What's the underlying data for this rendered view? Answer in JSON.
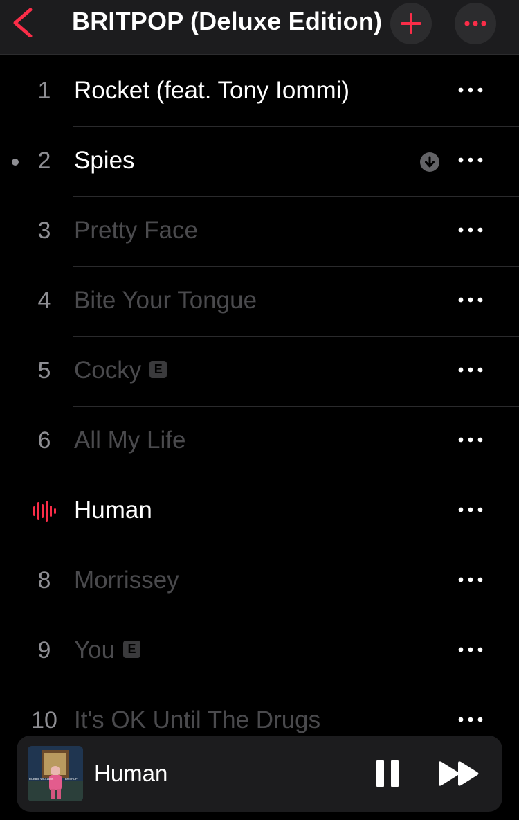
{
  "header": {
    "title": "BRITPOP (Deluxe Edition)",
    "back_icon": "chevron-left-icon",
    "add_icon": "plus-icon",
    "more_icon": "ellipsis-icon",
    "accent_color": "#fa2d48"
  },
  "tracks": [
    {
      "number": "1",
      "title": "Rocket (feat. Tony Iommi)",
      "state": "available",
      "explicit": false
    },
    {
      "number": "2",
      "title": "Spies",
      "state": "available",
      "explicit": false,
      "downloaded": true,
      "marked": true
    },
    {
      "number": "3",
      "title": "Pretty Face",
      "state": "unavailable",
      "explicit": false
    },
    {
      "number": "4",
      "title": "Bite Your Tongue",
      "state": "unavailable",
      "explicit": false
    },
    {
      "number": "5",
      "title": "Cocky",
      "state": "unavailable",
      "explicit": true
    },
    {
      "number": "6",
      "title": "All My Life",
      "state": "unavailable",
      "explicit": false
    },
    {
      "number": "",
      "title": "Human",
      "state": "playing",
      "explicit": false
    },
    {
      "number": "8",
      "title": "Morrissey",
      "state": "unavailable",
      "explicit": false
    },
    {
      "number": "9",
      "title": "You",
      "state": "unavailable",
      "explicit": true
    },
    {
      "number": "10",
      "title": "It's OK Until The Drugs",
      "state": "unavailable",
      "explicit": false
    }
  ],
  "explicit_badge": "E",
  "player": {
    "title": "Human",
    "art_text_left": "ROBBIE WILLIAMS",
    "art_text_right": "BRITPOP",
    "pause_icon": "pause-icon",
    "next_icon": "forward-icon"
  }
}
